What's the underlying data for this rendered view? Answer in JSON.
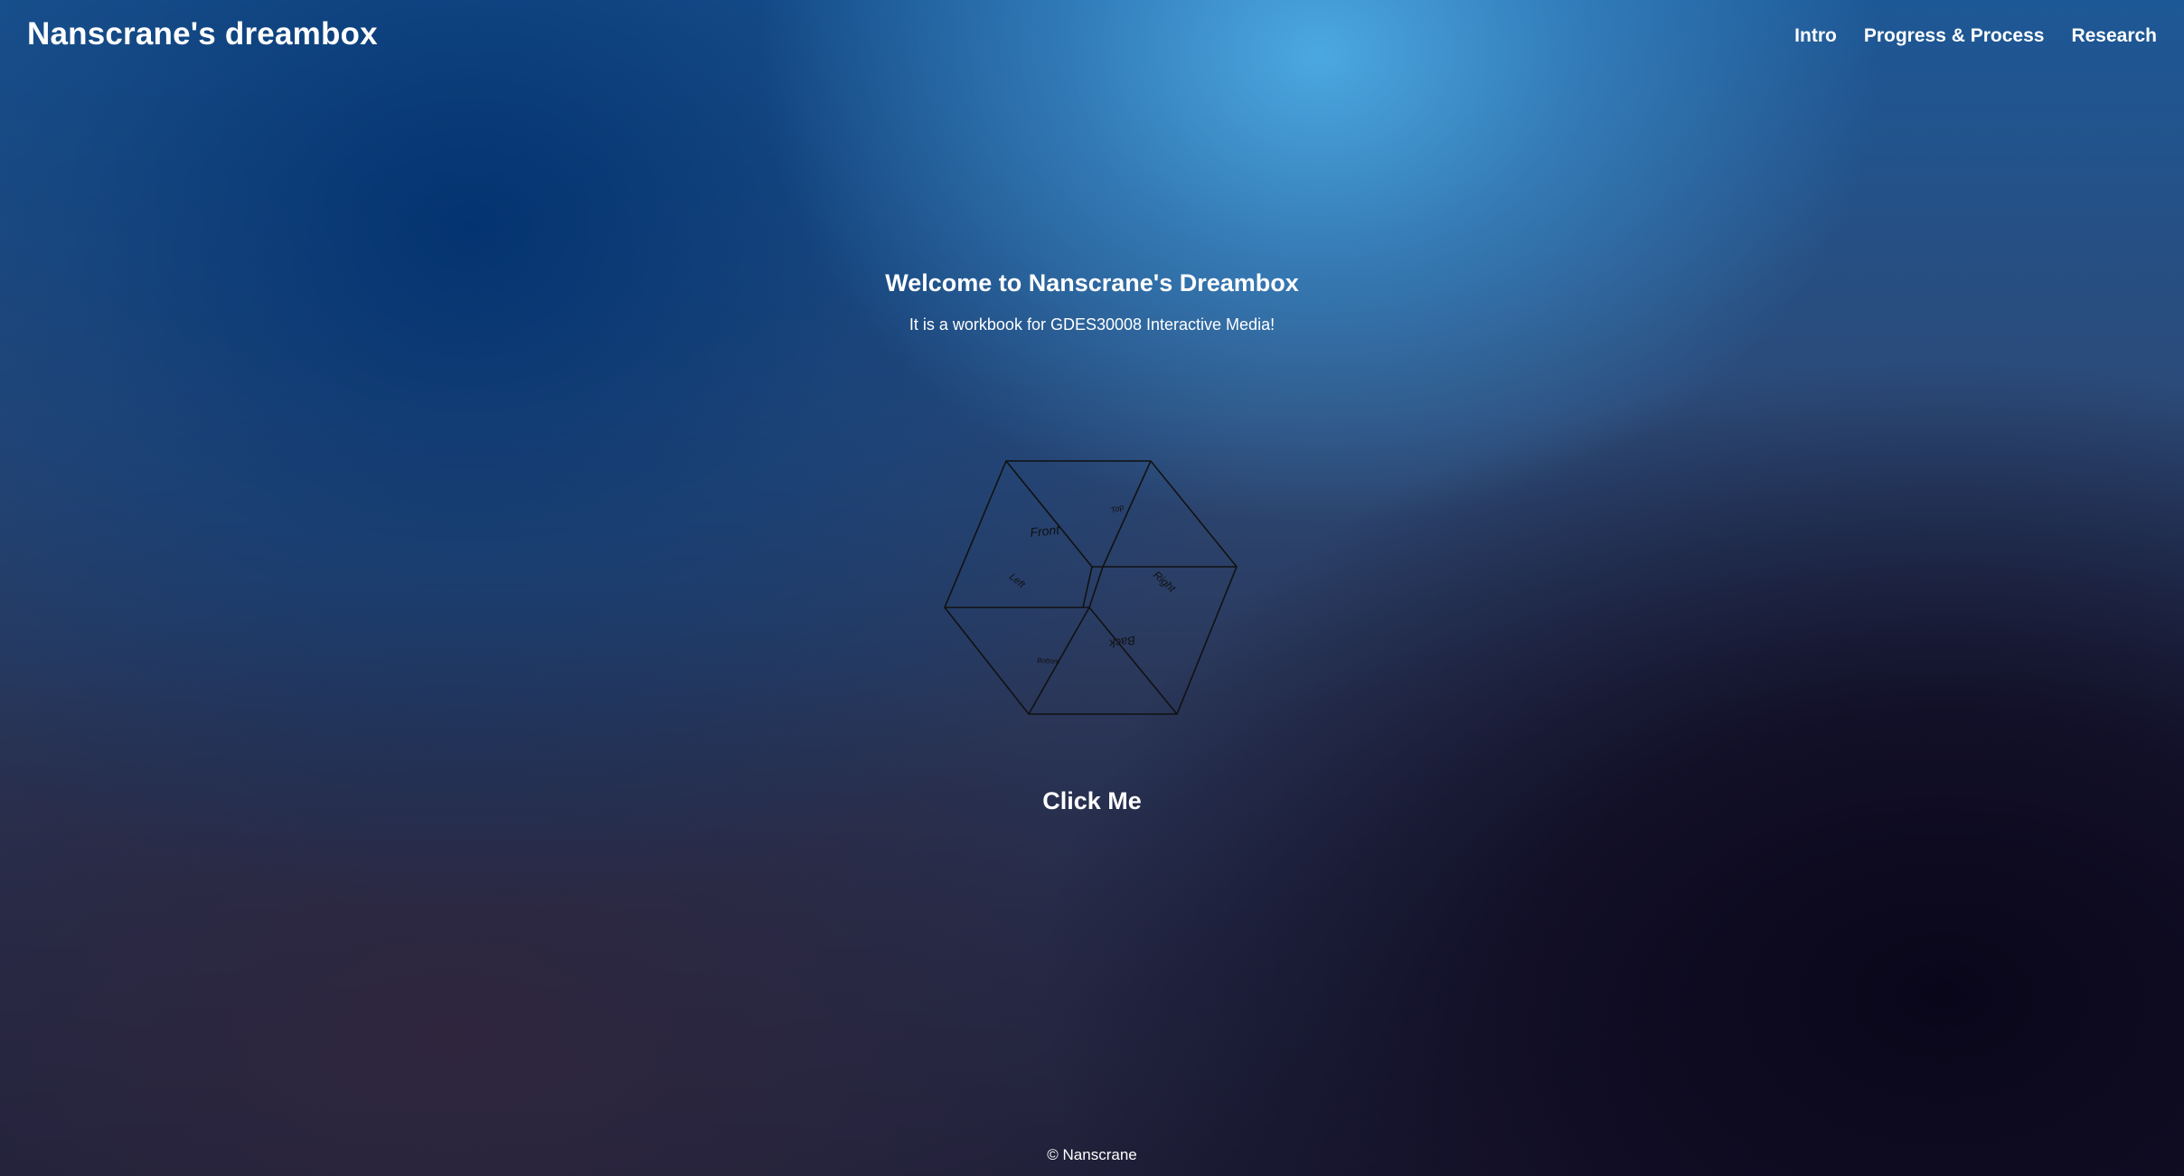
{
  "header": {
    "site_title": "Nanscrane's dreambox",
    "nav": [
      {
        "label": "Intro"
      },
      {
        "label": "Progress & Process"
      },
      {
        "label": "Research"
      }
    ]
  },
  "hero": {
    "title": "Welcome to Nanscrane's Dreambox",
    "subtitle": "It is a workbook for GDES30008 Interactive Media!"
  },
  "cube": {
    "faces": {
      "front": "Front",
      "top": "Top",
      "left": "Left",
      "right": "Right",
      "back": "Back",
      "bottom": "Bottom"
    },
    "stroke_color": "#111111"
  },
  "actions": {
    "click_label": "Click Me"
  },
  "footer": {
    "copyright": "© Nanscrane"
  }
}
